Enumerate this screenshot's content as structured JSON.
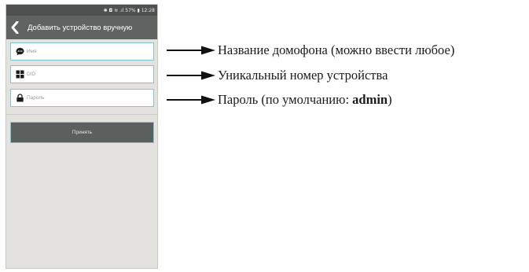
{
  "status_bar": {
    "text": "✱ ◘ ≋ .ıl 57% ▮ 12:28"
  },
  "app_bar": {
    "title": "Добавить устройство вручную",
    "back_icon": "chevron-left-icon"
  },
  "form": {
    "name_field": {
      "placeholder": "Имя",
      "value": "",
      "icon": "chat-bubble-icon"
    },
    "did_field": {
      "placeholder": "DID",
      "value": "",
      "icon": "grid-icon"
    },
    "password_field": {
      "placeholder": "Пароль",
      "value": "",
      "icon": "lock-icon"
    },
    "submit_label": "Принять"
  },
  "annotations": {
    "name": "Название домофона (можно ввести любое)",
    "did": "Уникальный номер устройства",
    "password_prefix": "Пароль (по умолчанию: ",
    "password_default": "admin",
    "password_suffix": ")"
  },
  "colors": {
    "appbar": "#5f6462",
    "statusbar": "#4e5150",
    "field_border": "#7fc6ce",
    "screen_bg": "#e3e2de",
    "button_bg": "#5b5f5d"
  }
}
